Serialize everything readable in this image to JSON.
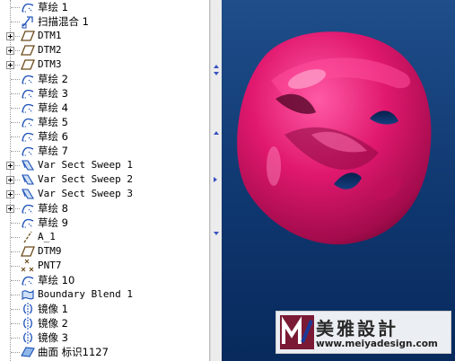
{
  "model_tree": {
    "items": [
      {
        "label": "草绘 1",
        "icon": "sketch-icon"
      },
      {
        "label": "扫描混合 1",
        "icon": "swept-blend-icon"
      },
      {
        "label": "DTM1",
        "icon": "datum-plane-icon"
      },
      {
        "label": "DTM2",
        "icon": "datum-plane-icon"
      },
      {
        "label": "DTM3",
        "icon": "datum-plane-icon"
      },
      {
        "label": "草绘 2",
        "icon": "sketch-icon"
      },
      {
        "label": "草绘 3",
        "icon": "sketch-icon"
      },
      {
        "label": "草绘 4",
        "icon": "sketch-icon"
      },
      {
        "label": "草绘 5",
        "icon": "sketch-icon"
      },
      {
        "label": "草绘 6",
        "icon": "sketch-icon"
      },
      {
        "label": "草绘 7",
        "icon": "sketch-icon"
      },
      {
        "label": "Var Sect Sweep 1",
        "icon": "var-sect-sweep-icon"
      },
      {
        "label": "Var Sect Sweep 2",
        "icon": "var-sect-sweep-icon"
      },
      {
        "label": "Var Sect Sweep 3",
        "icon": "var-sect-sweep-icon"
      },
      {
        "label": "草绘 8",
        "icon": "sketch-icon"
      },
      {
        "label": "草绘 9",
        "icon": "sketch-icon"
      },
      {
        "label": "A_1",
        "icon": "datum-axis-icon"
      },
      {
        "label": "DTM9",
        "icon": "datum-plane-icon"
      },
      {
        "label": "PNT7",
        "icon": "datum-point-icon"
      },
      {
        "label": "草绘 10",
        "icon": "sketch-icon"
      },
      {
        "label": "Boundary Blend 1",
        "icon": "boundary-blend-icon"
      },
      {
        "label": "镜像 1",
        "icon": "mirror-icon"
      },
      {
        "label": "镜像 2",
        "icon": "mirror-icon"
      },
      {
        "label": "镜像 3",
        "icon": "mirror-icon"
      },
      {
        "label": "曲面 标识1127",
        "icon": "surface-icon"
      }
    ]
  },
  "viewport": {
    "model_color": "#e0186e",
    "background_top": "#1f4e8a",
    "background_bottom": "#082a5c"
  },
  "watermark": {
    "logo_letter": "M",
    "title": "美雅設計",
    "url": "www.meiyadesign.com"
  }
}
